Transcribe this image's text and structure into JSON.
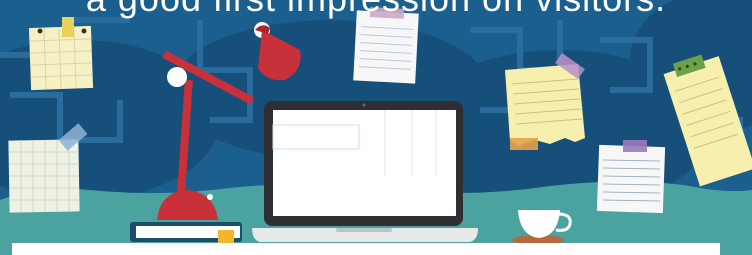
{
  "headline": "a good first impression on visitors.",
  "colors": {
    "wall": "#1b5f8f",
    "wall_dark": "#134d77",
    "desk": "#4aa39e",
    "lamp_red": "#c8303a",
    "paper_yellow": "#f7efad",
    "paper_white": "#f7f7f7",
    "laptop_frame": "#2f2f33",
    "book_cover": "#1c4d6b",
    "bookmark": "#f2b62e"
  },
  "icons": [
    "desk-lamp-icon",
    "laptop-icon",
    "book-icon",
    "coffee-cup-icon",
    "sticky-note-icon"
  ]
}
